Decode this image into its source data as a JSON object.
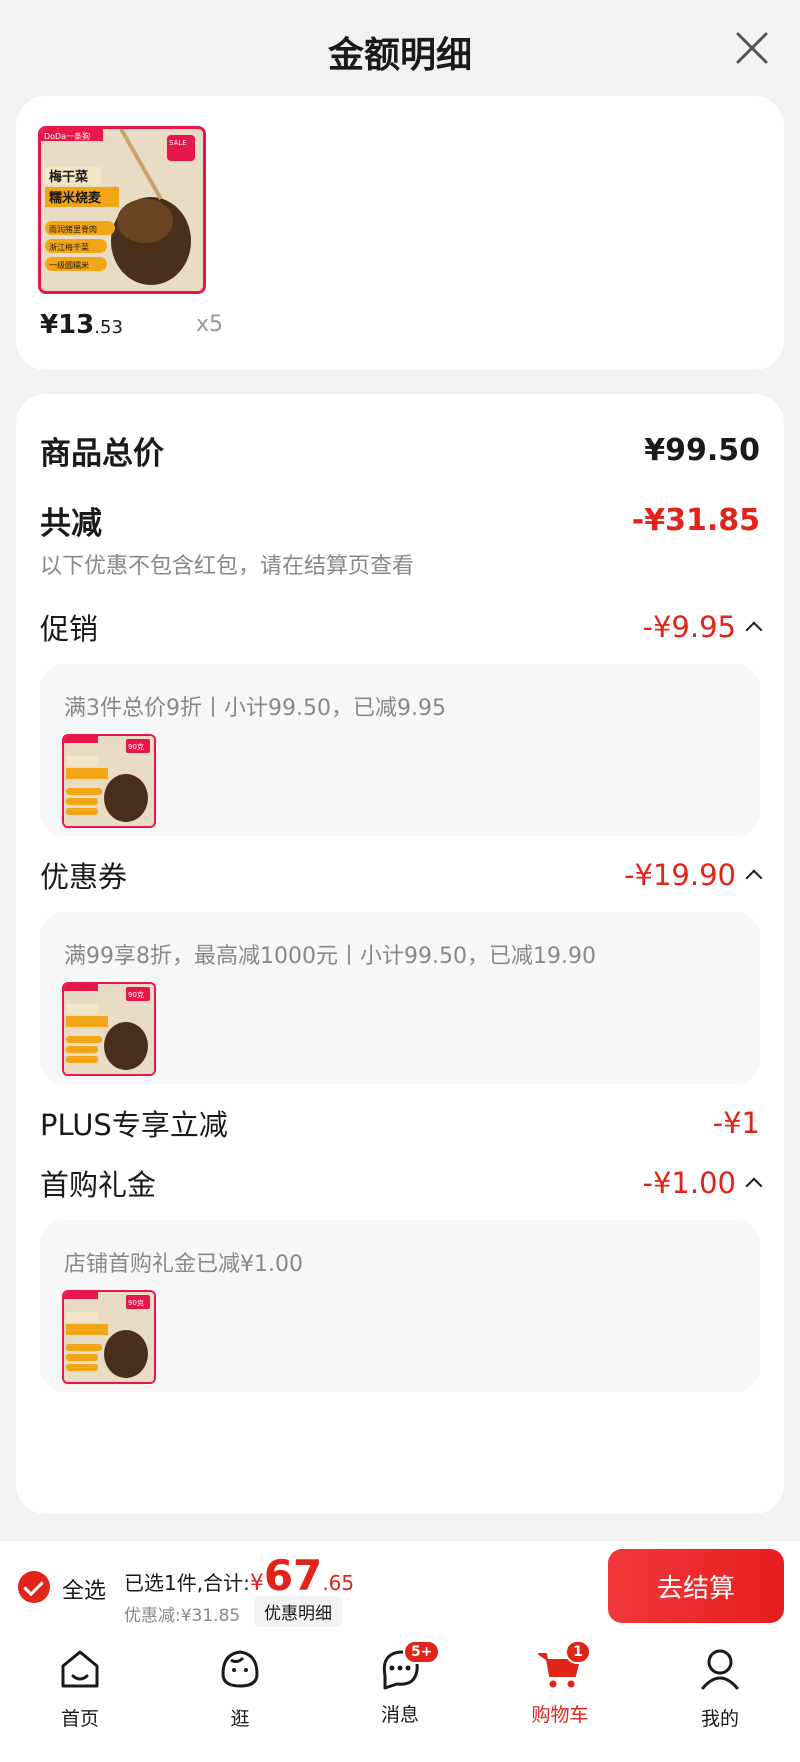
{
  "header": {
    "title": "金额明细"
  },
  "product": {
    "image_texts": [
      "DoDa一条狗",
      "SALE",
      "梅干菜",
      "糯米烧麦",
      "雨润猪里脊肉",
      "浙江梅干菜",
      "一级圆糯米",
      "90克"
    ],
    "price_main": "¥13",
    "price_cents": ".53",
    "qty": "x5"
  },
  "summary": {
    "total_label": "商品总价",
    "total_value": "¥99.50",
    "reduce_label": "共减",
    "reduce_value": "-¥31.85",
    "reduce_note": "以下优惠不包含红包，请在结算页查看",
    "promo_label": "促销",
    "promo_value": "-¥9.95",
    "promo_detail": "满3件总价9折丨小计99.50，已减9.95",
    "coupon_label": "优惠券",
    "coupon_value": "-¥19.90",
    "coupon_detail": "满99享8折，最高减1000元丨小计99.50，已减19.90",
    "plus_label": "PLUS专享立减",
    "plus_value": "-¥1",
    "gift_label": "首购礼金",
    "gift_value": "-¥1.00",
    "gift_detail": "店铺首购礼金已减¥1.00"
  },
  "bottom": {
    "select_all": "全选",
    "selected_text": "已选1件,合计:",
    "total_yen": "¥",
    "total_big": "67",
    "total_small": ".65",
    "saved_text": "优惠减:¥31.85",
    "detail_btn": "优惠明细",
    "checkout": "去结算"
  },
  "tabs": [
    {
      "label": "首页"
    },
    {
      "label": "逛"
    },
    {
      "label": "消息",
      "badge": "5+"
    },
    {
      "label": "购物车",
      "badge": "1"
    },
    {
      "label": "我的"
    }
  ],
  "colors": {
    "accent": "#e2231a",
    "product_border": "#e8174b"
  }
}
